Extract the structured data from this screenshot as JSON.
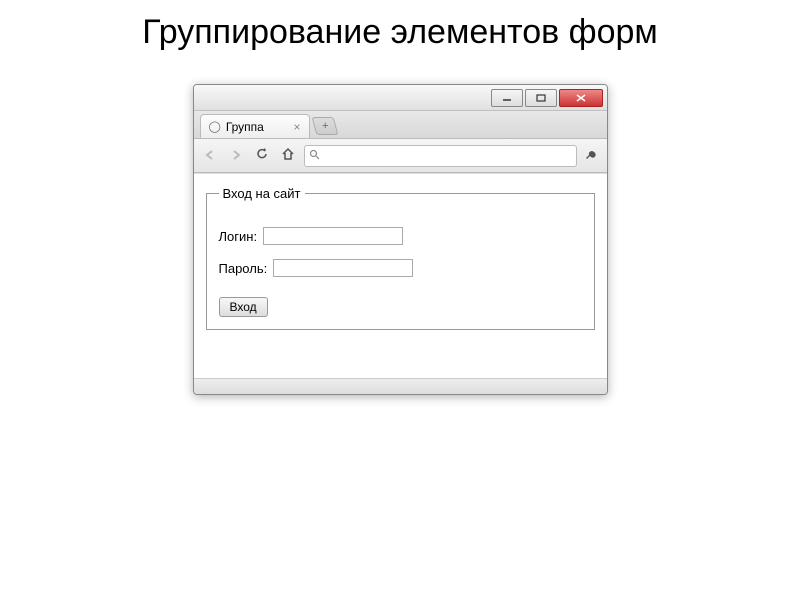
{
  "slide": {
    "title": "Группирование элементов форм"
  },
  "browser": {
    "tab_title": "Группа"
  },
  "form": {
    "legend": "Вход на сайт",
    "login_label": "Логин:",
    "password_label": "Пароль:",
    "submit_label": "Вход",
    "login_value": "",
    "password_value": ""
  }
}
